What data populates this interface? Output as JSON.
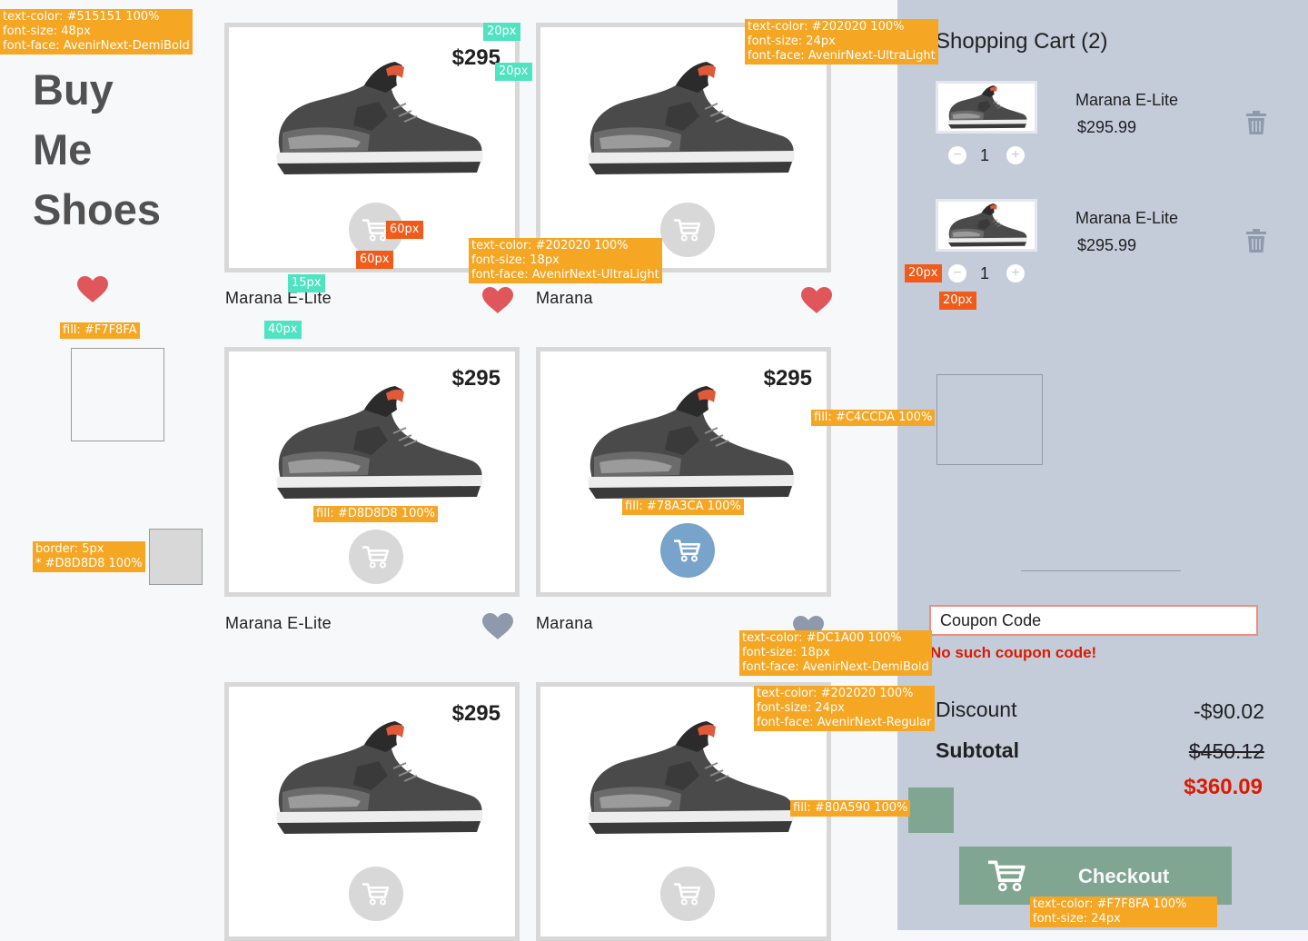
{
  "brand": {
    "title_lines": [
      "Buy",
      "Me",
      "Shoes"
    ]
  },
  "colors": {
    "heading_text": "#515151",
    "body_text": "#202020",
    "error_text": "#DC1A00",
    "card_border": "#D8D8D8",
    "cart_button": "#D8D8D8",
    "cart_button_active": "#78A3CA",
    "favorite_active": "#E0575B",
    "favorite_inactive": "#8E9AAB",
    "cart_panel_bg": "#C4CCDA",
    "page_bg": "#F7F8FA",
    "checkout_bg": "#80A590",
    "annotation": "#F5A623"
  },
  "products": [
    {
      "name": "Marana E-Lite",
      "price": "$295",
      "favorite": true,
      "cart_active": false
    },
    {
      "name": "Marana",
      "price": "",
      "favorite": true,
      "cart_active": false
    },
    {
      "name": "Marana E-Lite",
      "price": "$295",
      "favorite": false,
      "cart_active": false
    },
    {
      "name": "Marana",
      "price": "$295",
      "favorite": false,
      "cart_active": true
    },
    {
      "name": "",
      "price": "$295",
      "favorite": false,
      "cart_active": false
    },
    {
      "name": "",
      "price": "",
      "favorite": false,
      "cart_active": false
    }
  ],
  "cart": {
    "title": "Shopping Cart (2)",
    "items": [
      {
        "name": "Marana E-Lite",
        "price": "$295.99",
        "qty": "1",
        "minus": "−",
        "plus": "+"
      },
      {
        "name": "Marana E-Lite",
        "price": "$295.99",
        "qty": "1",
        "minus": "−",
        "plus": "+"
      }
    ],
    "coupon_placeholder": "Coupon Code",
    "coupon_error": "No such coupon code!",
    "discount_label": "Discount",
    "discount_value": "-$90.02",
    "subtotal_label": "Subtotal",
    "subtotal_value": "$450.12",
    "total_value": "$360.09",
    "checkout_label": "Checkout"
  },
  "icons": {
    "favorite": "heart-icon",
    "add_to_cart": "shopping-cart-icon",
    "remove": "trash-icon",
    "decrement": "minus-icon",
    "increment": "plus-icon"
  },
  "annotations": {
    "title_spec": "text-color: #515151 100%\nfont-size: 48px\nfont-face: AvenirNext-DemiBold",
    "cart_title_spec": "text-color: #202020 100%\nfont-size: 24px\nfont-face: AvenirNext-UltraLight",
    "name_spec": "text-color: #202020 100%\nfont-size: 18px\nfont-face: AvenirNext-UltraLight",
    "fill_page": "fill: #F7F8FA",
    "border_spec": "border: 5px\n* #D8D8D8 100%",
    "fill_cart_btn": "fill: #D8D8D8 100%",
    "fill_cart_active": "fill: #78A3CA 100%",
    "fill_panel": "fill: #C4CCDA 100%",
    "error_spec": "text-color: #DC1A00 100%\nfont-size: 18px\nfont-face: AvenirNext-DemiBold",
    "summary_spec": "text-color: #202020 100%\nfont-size: 24px\nfont-face: AvenirNext-Regular",
    "fill_checkout": "fill: #80A590 100%",
    "checkout_text_spec": "text-color: #F7F8FA 100%\nfont-size: 24px",
    "px20": "20px",
    "px60": "60px",
    "px15": "15px",
    "px40": "40px"
  }
}
